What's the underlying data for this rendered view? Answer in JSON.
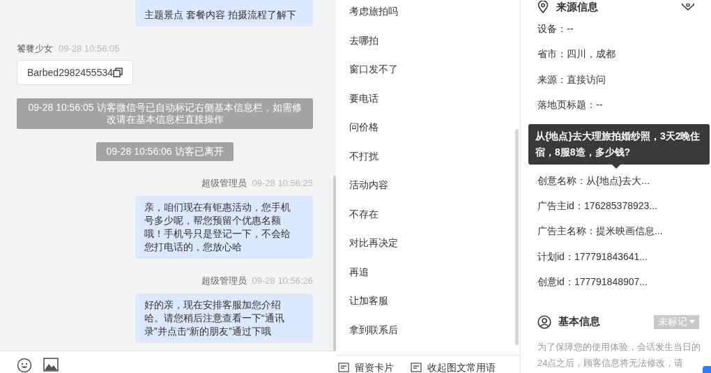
{
  "chat": {
    "messages": [
      {
        "kind": "bubble",
        "text": "主题景点 套餐内容 拍摄流程了解下"
      },
      {
        "kind": "card",
        "sender": "饕餮少女",
        "time": "09-28 10:56:05",
        "text": "Barbed2982455534"
      },
      {
        "kind": "system",
        "text": "09-28 10:56:05 访客微信号已自动标记右侧基本信息栏，如需修改请在基本信息栏直接操作"
      },
      {
        "kind": "system",
        "text": "09-28 10:56:06 访客已离开"
      },
      {
        "kind": "bubble",
        "sender": "超级管理员",
        "time": "09-28 10:56:25",
        "text": "亲，咱们现在有钜惠活动，您手机号多少呢，帮您预留个优惠名额哦！手机号只是登记一下，不会给您打电话的，您放心哈"
      },
      {
        "kind": "bubble",
        "sender": "超级管理员",
        "time": "09-28 10:56:26",
        "text": "好的亲，现在安排客服加您介绍哈。请您稍后注意查看一下“通讯录”并点击“新的朋友”通过下哦"
      }
    ]
  },
  "quick_replies": {
    "items": [
      "考虑旅拍吗",
      "去哪拍",
      "窗口发不了",
      "要电话",
      "问价格",
      "不打扰",
      "活动内容",
      "不存在",
      "对比再决定",
      "再追",
      "让加客服",
      "拿到联系后"
    ],
    "footer": [
      "留资卡片",
      "收起图文常用语"
    ]
  },
  "source_info": {
    "title": "来源信息",
    "rows_top": [
      "设备：--",
      "省市：四川，成都",
      "来源：直接访问",
      "落地页标题：--"
    ],
    "rows_bottom": [
      "创意名称：从{地点}去大...",
      "广告主id：176285378923...",
      "广告主名称：提米映画信息...",
      "计划id：177791843641...",
      "创意id：177791848907..."
    ],
    "tooltip": "从{地点}去大理旅拍婚纱照，3天2晚住宿，8服8造，多少钱?"
  },
  "basic_info": {
    "title": "基本信息",
    "tag": "未标记",
    "note": "为了保障您的使用体验，会话发生当日的24点之后，顾客信息将无法修改，请"
  }
}
